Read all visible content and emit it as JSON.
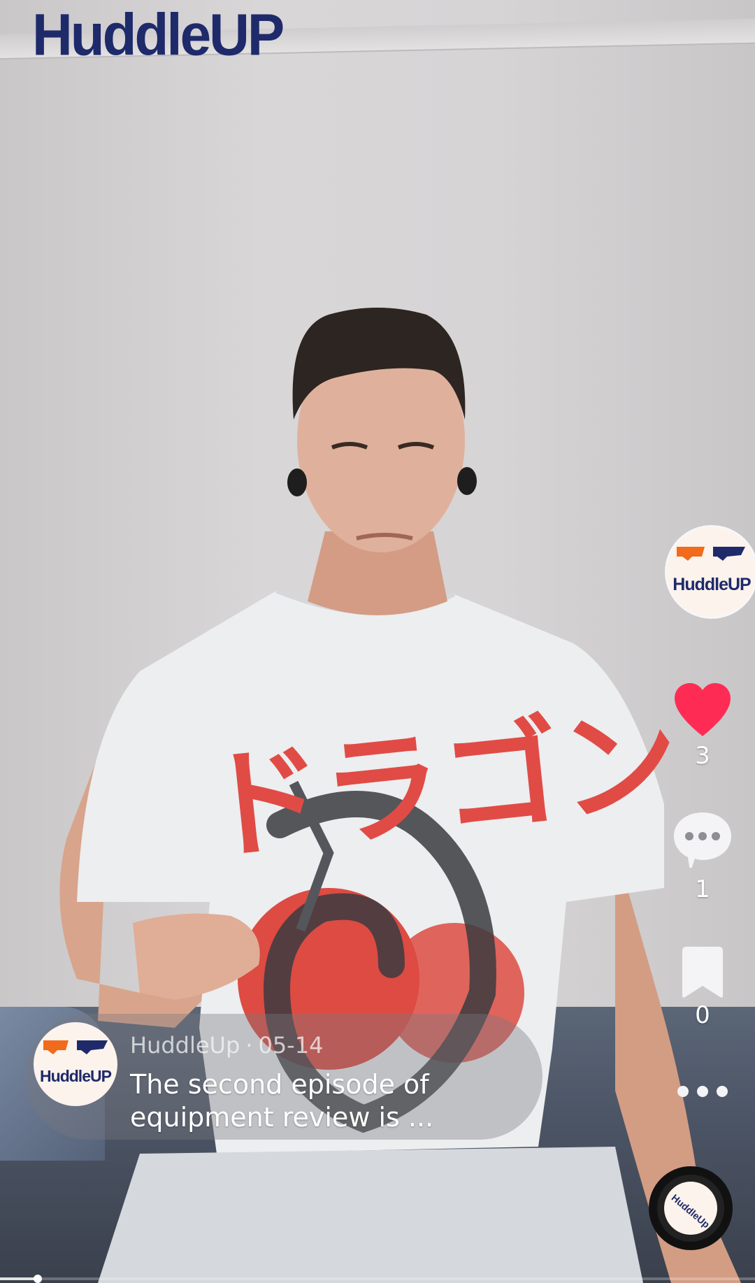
{
  "watermark": "HuddleUP",
  "channel": {
    "avatar_logo_text": "HuddleUP",
    "name": "HuddleUp",
    "date": "05-14"
  },
  "caption": {
    "separator": "·",
    "text": "The second episode of equipment review is ..."
  },
  "actions": {
    "likes": "3",
    "comments": "1",
    "saves": "0"
  },
  "music_disc": {
    "logo_text": "HuddleUp"
  },
  "shirt_print_text": "ドラゴン",
  "playback": {
    "progress_fraction": 0.05
  },
  "colors": {
    "like_active": "#fe2c55",
    "brand_navy": "#1f2a6b",
    "brand_orange": "#f26a1b"
  },
  "icons": [
    "heart-icon",
    "comment-icon",
    "bookmark-icon",
    "more-icon",
    "music-disc-icon"
  ]
}
